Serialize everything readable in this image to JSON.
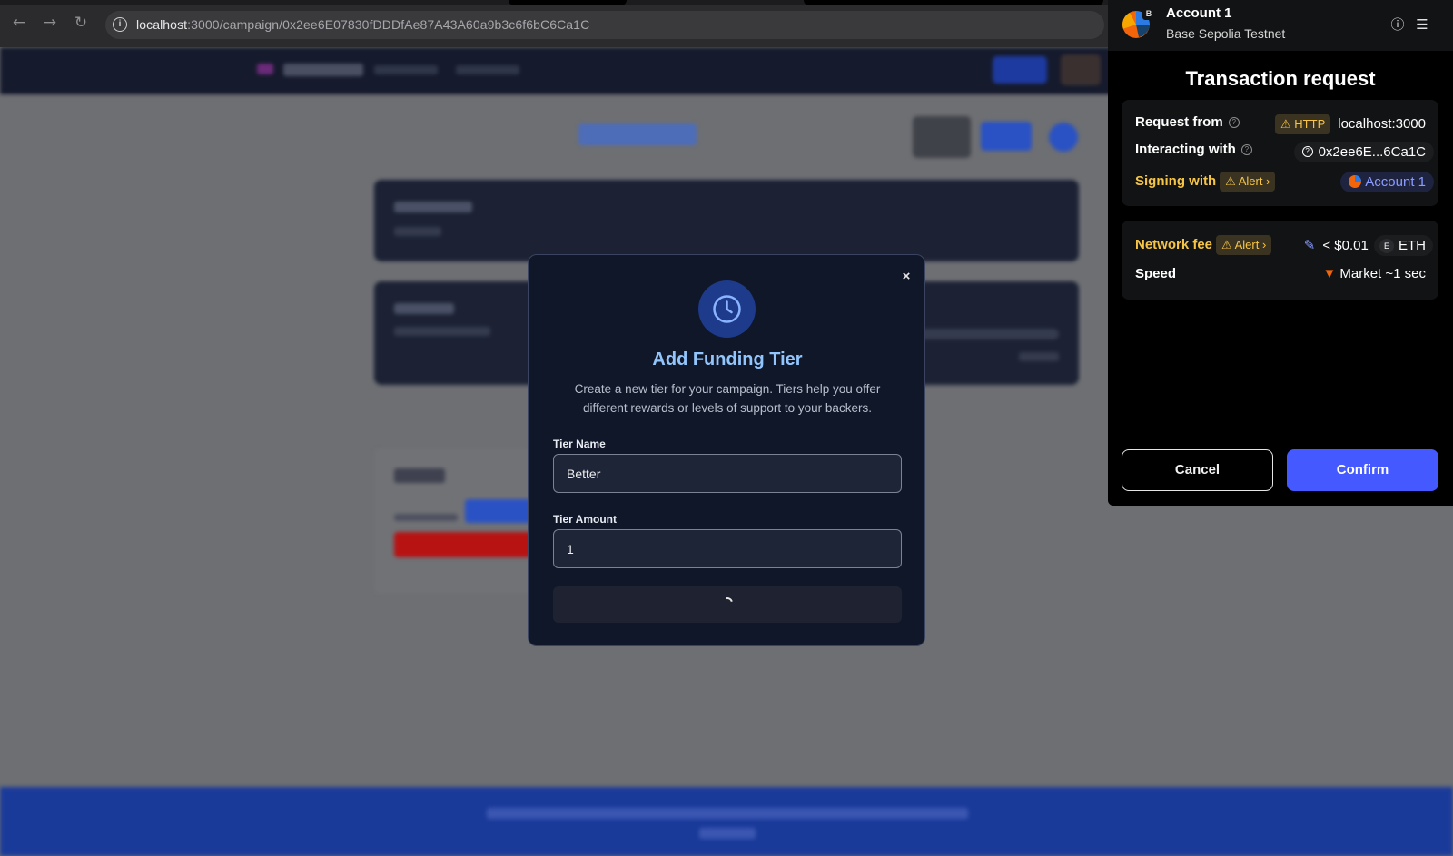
{
  "browser": {
    "url_host": "localhost",
    "url_path": ":3000/campaign/0x2ee6E07830fDDDfAe87A43A60a9b3c6f6bC6Ca1C",
    "back_icon": "back-arrow-icon",
    "forward_icon": "forward-arrow-icon",
    "reload_icon": "reload-icon"
  },
  "modal": {
    "title": "Add Funding Tier",
    "description": "Create a new tier for your campaign. Tiers help you offer different rewards or levels of support to your backers.",
    "close_label": "×",
    "tier_name_label": "Tier Name",
    "tier_name_value": "Better",
    "tier_amount_label": "Tier Amount",
    "tier_amount_value": "1",
    "icon": "clock-icon",
    "accent": "#93c5fd"
  },
  "wallet": {
    "account_name": "Account 1",
    "network": "Base Sepolia Testnet",
    "network_badge": "B",
    "title": "Transaction request",
    "request_from_label": "Request from",
    "http_badge": "HTTP",
    "request_from_value": "localhost:3000",
    "interacting_label": "Interacting with",
    "interacting_value": "0x2ee6E...6Ca1C",
    "signing_label": "Signing with",
    "alert_label": "Alert",
    "signing_account": "Account 1",
    "network_fee_label": "Network fee",
    "fee_value": "< $0.01",
    "fee_token_badge": "E",
    "fee_token": "ETH",
    "speed_label": "Speed",
    "speed_value": "Market ~1 sec",
    "cancel_label": "Cancel",
    "confirm_label": "Confirm",
    "confirm_color": "#4459ff",
    "warning_color": "#f7c545"
  }
}
